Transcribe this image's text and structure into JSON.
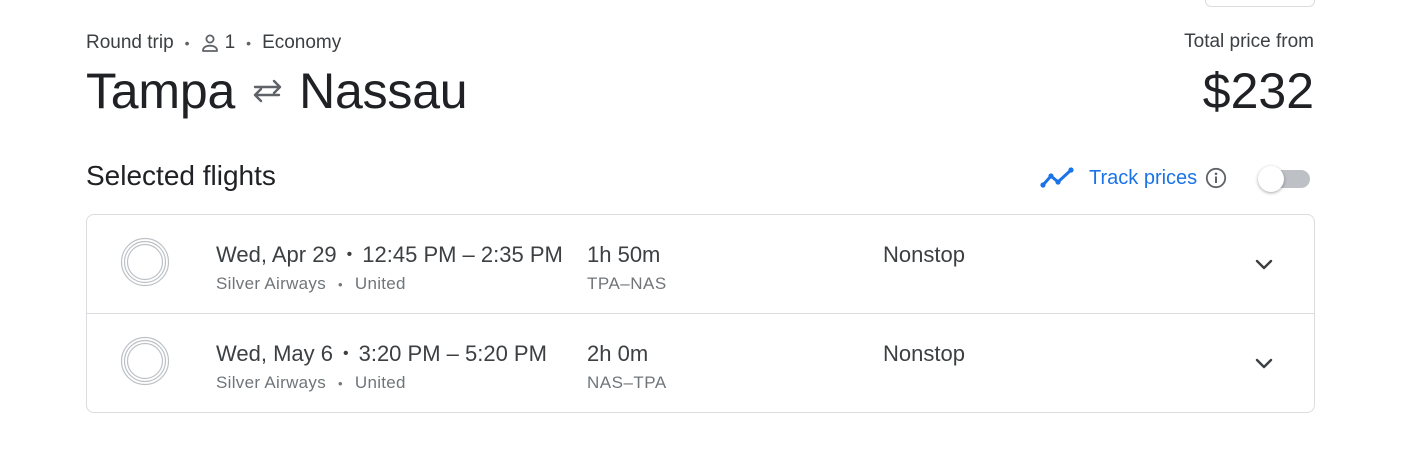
{
  "trip": {
    "type": "Round trip",
    "passengers": "1",
    "cabin": "Economy",
    "origin": "Tampa",
    "destination": "Nassau"
  },
  "price": {
    "label": "Total price from",
    "amount": "$232"
  },
  "section": {
    "title": "Selected flights"
  },
  "track": {
    "label": "Track prices",
    "enabled": false
  },
  "flights": [
    {
      "date": "Wed, Apr 29",
      "times": "12:45 PM – 2:35 PM",
      "airline": "Silver Airways",
      "operator": "United",
      "duration": "1h 50m",
      "airports": "TPA–NAS",
      "stops": "Nonstop"
    },
    {
      "date": "Wed, May 6",
      "times": "3:20 PM – 5:20 PM",
      "airline": "Silver Airways",
      "operator": "United",
      "duration": "2h 0m",
      "airports": "NAS–TPA",
      "stops": "Nonstop"
    }
  ],
  "icons": {
    "person": "person-icon",
    "swap": "swap-arrows-icon",
    "trend": "trend-line-icon",
    "info": "info-icon",
    "logo": "airline-logo-icon",
    "expand": "chevron-down-icon"
  },
  "colors": {
    "accent": "#1a73e8",
    "text": "#202124",
    "secondary": "#70757a",
    "border": "#dadce0"
  }
}
